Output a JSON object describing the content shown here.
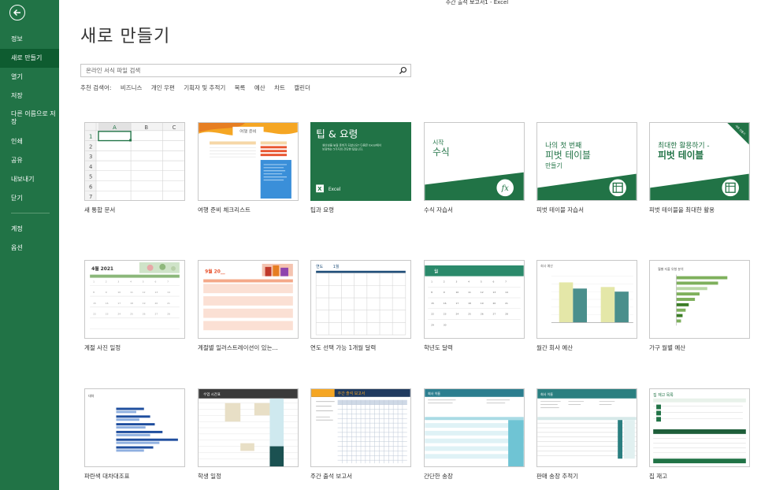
{
  "window": {
    "title": "주간 출석 보고서1 - Excel"
  },
  "sidebar": {
    "items": [
      {
        "label": "정보"
      },
      {
        "label": "새로 만들기"
      },
      {
        "label": "열기"
      },
      {
        "label": "저장"
      },
      {
        "label": "다른 이름으로 저장"
      },
      {
        "label": "인쇄"
      },
      {
        "label": "공유"
      },
      {
        "label": "내보내기"
      },
      {
        "label": "닫기"
      },
      {
        "label": "계정"
      },
      {
        "label": "옵션"
      }
    ],
    "active_index": 1
  },
  "main": {
    "title": "새로 만들기",
    "search": {
      "placeholder": "온라인 서식 파일 검색"
    },
    "suggested_label": "추천 검색어:",
    "suggested": [
      "비즈니스",
      "개인 우편",
      "기획자 및 추적기",
      "목록",
      "예산",
      "차트",
      "캘린더"
    ]
  },
  "templates": [
    {
      "name": "새 통합 문서"
    },
    {
      "name": "여행 준비 체크리스트"
    },
    {
      "name": "팁과 요령"
    },
    {
      "name": "수식 자습서"
    },
    {
      "name": "피벗 테이블 자습서"
    },
    {
      "name": "피벗 테이블을 최대한 활용"
    },
    {
      "name": "계절 사진 일정"
    },
    {
      "name": "계절별 일러스트레이션이 있는..."
    },
    {
      "name": "연도 선택 가능 1개월 달력"
    },
    {
      "name": "학년도 달력"
    },
    {
      "name": "월간 회사 예산"
    },
    {
      "name": "가구 월별 예산"
    },
    {
      "name": "파란색 대차대조표"
    },
    {
      "name": "학생 일정"
    },
    {
      "name": "주간 출석 보고서"
    },
    {
      "name": "간단한 송장"
    },
    {
      "name": "판매 송장 추적기"
    },
    {
      "name": "집 재고"
    }
  ],
  "thumbs": {
    "blank": {
      "col_a": "A",
      "col_b": "B",
      "col_c": "C",
      "rows": [
        "1",
        "2",
        "3",
        "4",
        "5",
        "6",
        "7"
      ]
    },
    "travel": {
      "heading": "여행 준비"
    },
    "tips": {
      "heading": "팁 & 요령",
      "body_line1": "생산성을 높일 준비가 되셨나요? 다음은 Excel에서",
      "body_line2": "보장하는 5가지의 간단한 팁입니다.",
      "app": "Excel"
    },
    "formula": {
      "line1": "시작",
      "line2": "수식"
    },
    "pivot1": {
      "line1": "나의 첫 번째",
      "line2": "피벗 테이블",
      "line3": "만들기"
    },
    "pivot2": {
      "line1": "최대한 활용하기 -",
      "line2": "피벗 테이블",
      "ribbon": "새로 만들기"
    },
    "seasonal": {
      "heading": "4월 2021"
    },
    "illustrated": {
      "heading": "9월 20__"
    },
    "yearcal": {
      "year": "연도",
      "month": "1월"
    },
    "school": {
      "month": "월"
    },
    "weekly": {
      "heading": "주간 출석 보고서"
    },
    "student": {
      "heading": "수업 시간표"
    },
    "invoice": {
      "heading": "회사 이름"
    },
    "sales": {
      "heading": "회사 이름"
    },
    "inventory": {
      "heading": "집 재고 목록"
    },
    "budget": {
      "heading": "회사 예산"
    },
    "household": {
      "heading": "월별 지출 유형 분석"
    },
    "balance": {
      "heading": "대차"
    }
  },
  "colors": {
    "excel_green": "#217346",
    "active_nav": "#0e5c30",
    "accent_blue": "#1f4e79"
  }
}
